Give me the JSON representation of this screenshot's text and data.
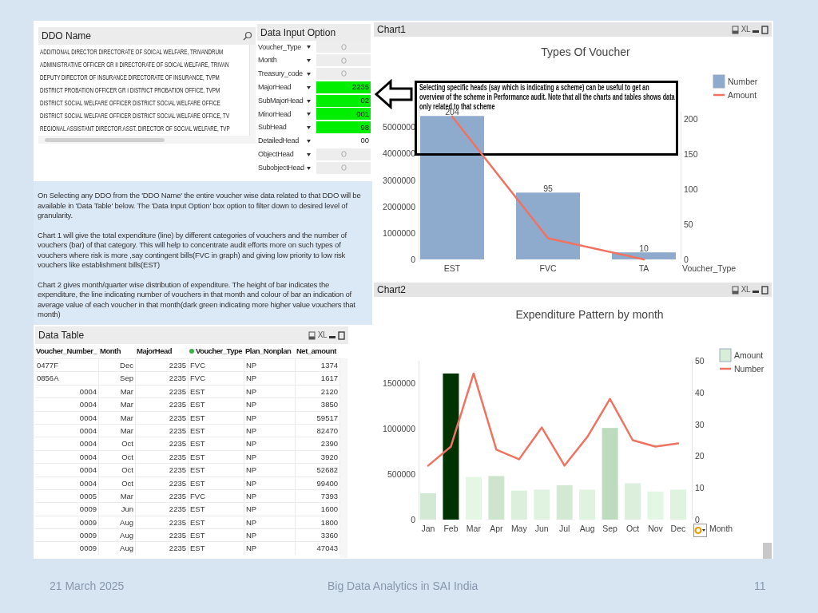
{
  "ddo_list": {
    "title": "DDO Name",
    "items": [
      "ADDITIONAL DIRECTOR DIRECTORATE OF SOICAL WELFARE, TRIVANDRUM",
      "ADMINISTRATIVE OFFICER GR II DIRECTORATE OF SOICAL WELFARE, TRIVAN",
      "DEPUTY DIRECTOR OF INSURANCE DIRECTORATE OF INSURANCE, TVPM",
      "DISTRICT PROBATION OFFICER GR I DISTRICT PROBATION OFFICE, TVPM",
      "DISTRICT SOCIAL WELFARE OFFICER DISTRICT SOCIAL WELFARE OFFICE",
      "DISTRICT SOCIAL WELFARE OFFICER DISTRICT SOCIAL WELFARE OFFICE, TV",
      "REGIONAL ASSISTANT DIRECTOR ASST. DIRECTOR OF SOCIAL WELFARE, TVP"
    ]
  },
  "data_input": {
    "title": "Data Input Option",
    "fields": [
      {
        "label": "Voucher_Type",
        "selected": false
      },
      {
        "label": "Month",
        "selected": false
      },
      {
        "label": "Treasury_code",
        "selected": false
      },
      {
        "label": "MajorHead",
        "value": "2235",
        "selected": true
      },
      {
        "label": "SubMajorHead",
        "value": "02",
        "selected": true
      },
      {
        "label": "MinorHead",
        "value": "001",
        "selected": true
      },
      {
        "label": "SubHead",
        "value": "98",
        "selected": true
      },
      {
        "label": "DetailedHead",
        "value": "00",
        "selected": false
      },
      {
        "label": "ObjectHead",
        "selected": false
      },
      {
        "label": "SubobjectHead",
        "selected": false
      }
    ]
  },
  "notes": {
    "paragraphs": [
      "On Selecting any DDO from the 'DDO Name' the entire voucher wise data related to that DDO will be available in 'Data Table' below. The 'Data Input Option' box option to filter down to desired level of granularity.",
      "Chart 1 will give the total expenditure (line) by different categories of vouchers and the number of vouchers (bar) of that category. This will help to concentrate audit efforts more on such types of vouchers where risk is more ,say contingent bills(FVC in graph) and giving low priority to low risk vouchers like establishment bills(EST)",
      "Chart 2 gives month/quarter wise distribution of expenditure. The height of bar indicates the expenditure, the line indicating number of vouchers in that month and colour of bar an indication of average value of each voucher in that month(dark green indicating more higher value vouchers that month)"
    ]
  },
  "data_table": {
    "title": "Data Table",
    "export_label": "XL",
    "columns": [
      {
        "label": "Voucher_Number_",
        "filtered": false
      },
      {
        "label": "Month",
        "filtered": false
      },
      {
        "label": "MajorHead",
        "filtered": false
      },
      {
        "label": "Voucher_Type",
        "filtered": true
      },
      {
        "label": "Plan_Nonplan",
        "filtered": false
      },
      {
        "label": "Net_amount",
        "filtered": false
      }
    ],
    "rows": [
      {
        "kind": "text",
        "cells": [
          "0477F",
          "Dec",
          "2235",
          "FVC",
          "NP",
          "1374"
        ]
      },
      {
        "kind": "text",
        "cells": [
          "0856A",
          "Sep",
          "2235",
          "FVC",
          "NP",
          "1617"
        ]
      },
      {
        "kind": "number",
        "cells": [
          "0004",
          "Mar",
          "2235",
          "EST",
          "NP",
          "2120"
        ]
      },
      {
        "kind": "number",
        "cells": [
          "0004",
          "Mar",
          "2235",
          "EST",
          "NP",
          "3850"
        ]
      },
      {
        "kind": "number",
        "cells": [
          "0004",
          "Mar",
          "2235",
          "EST",
          "NP",
          "59517"
        ]
      },
      {
        "kind": "number",
        "cells": [
          "0004",
          "Mar",
          "2235",
          "EST",
          "NP",
          "82470"
        ]
      },
      {
        "kind": "number",
        "cells": [
          "0004",
          "Oct",
          "2235",
          "EST",
          "NP",
          "2390"
        ]
      },
      {
        "kind": "number",
        "cells": [
          "0004",
          "Oct",
          "2235",
          "EST",
          "NP",
          "3920"
        ]
      },
      {
        "kind": "number",
        "cells": [
          "0004",
          "Oct",
          "2235",
          "EST",
          "NP",
          "52682"
        ]
      },
      {
        "kind": "number",
        "cells": [
          "0004",
          "Oct",
          "2235",
          "EST",
          "NP",
          "99400"
        ]
      },
      {
        "kind": "number",
        "cells": [
          "0005",
          "Mar",
          "2235",
          "FVC",
          "NP",
          "7393"
        ]
      },
      {
        "kind": "number",
        "cells": [
          "0009",
          "Jun",
          "2235",
          "EST",
          "NP",
          "1600"
        ]
      },
      {
        "kind": "number",
        "cells": [
          "0009",
          "Aug",
          "2235",
          "EST",
          "NP",
          "1800"
        ]
      },
      {
        "kind": "number",
        "cells": [
          "0009",
          "Aug",
          "2235",
          "EST",
          "NP",
          "3360"
        ]
      },
      {
        "kind": "number",
        "cells": [
          "0009",
          "Aug",
          "2235",
          "EST",
          "NP",
          "47043"
        ]
      }
    ]
  },
  "chart1": {
    "title": "Chart1",
    "export_label": "XL",
    "chart_data": {
      "type": "bar",
      "title": "Types Of Voucher",
      "xlabel": "Voucher_Type",
      "categories": [
        "EST",
        "FVC",
        "TA"
      ],
      "series": [
        {
          "name": "Number",
          "type": "bar",
          "axis": "y2",
          "color": "#8eaacd",
          "values": [
            204,
            95,
            10
          ]
        },
        {
          "name": "Amount",
          "type": "line",
          "color": "#f07261",
          "values": [
            5400000,
            800000,
            0
          ]
        }
      ],
      "ylim": [
        0,
        6000000
      ],
      "yticks": [
        0,
        1000000,
        2000000,
        3000000,
        4000000,
        5000000
      ],
      "y2lim": [
        0,
        210
      ],
      "y2ticks": [
        0,
        50,
        100,
        150,
        200
      ],
      "value_labels": [
        "204",
        "95",
        "10"
      ],
      "legend": "right"
    }
  },
  "callout": {
    "text": "Selecting specific heads (say which is indicating a scheme) can be useful to get an overview of the scheme in Performance audit. Note that all the charts and tables shows data only related to that scheme"
  },
  "chart2": {
    "title": "Chart2",
    "export_label": "XL",
    "chart_data": {
      "type": "bar",
      "title": "Expenditure Pattern by month",
      "xlabel": "Month",
      "categories": [
        "Jan",
        "Feb",
        "Mar",
        "Apr",
        "May",
        "Jun",
        "Jul",
        "Aug",
        "Sep",
        "Oct",
        "Nov",
        "Dec"
      ],
      "series": [
        {
          "name": "Amount",
          "type": "bar",
          "color": "#d9eed9",
          "colors": [
            "#d3e9d3",
            "#003300",
            "#e4f6e4",
            "#cce5cc",
            "#dcefdc",
            "#e0f3e0",
            "#d3e9d3",
            "#e0f3e0",
            "#bddbbd",
            "#dcefdc",
            "#e4f6e4",
            "#e0f3e0"
          ],
          "values": [
            290000,
            1610000,
            470000,
            480000,
            320000,
            330000,
            380000,
            330000,
            1010000,
            400000,
            310000,
            330000
          ]
        },
        {
          "name": "Number",
          "type": "line",
          "axis": "y2",
          "color": "#f07261",
          "values": [
            17,
            23,
            46,
            22,
            19,
            29,
            17,
            26,
            38,
            25,
            23,
            24
          ]
        }
      ],
      "ylim": [
        0,
        1750000
      ],
      "yticks": [
        0,
        500000,
        1000000,
        1500000
      ],
      "y2lim": [
        0,
        50
      ],
      "y2ticks": [
        0,
        10,
        20,
        30,
        40,
        50
      ],
      "legend": "right"
    }
  },
  "footer": {
    "date": "21 March 2025",
    "title": "Big Data Analytics in SAI India",
    "page": "11"
  }
}
